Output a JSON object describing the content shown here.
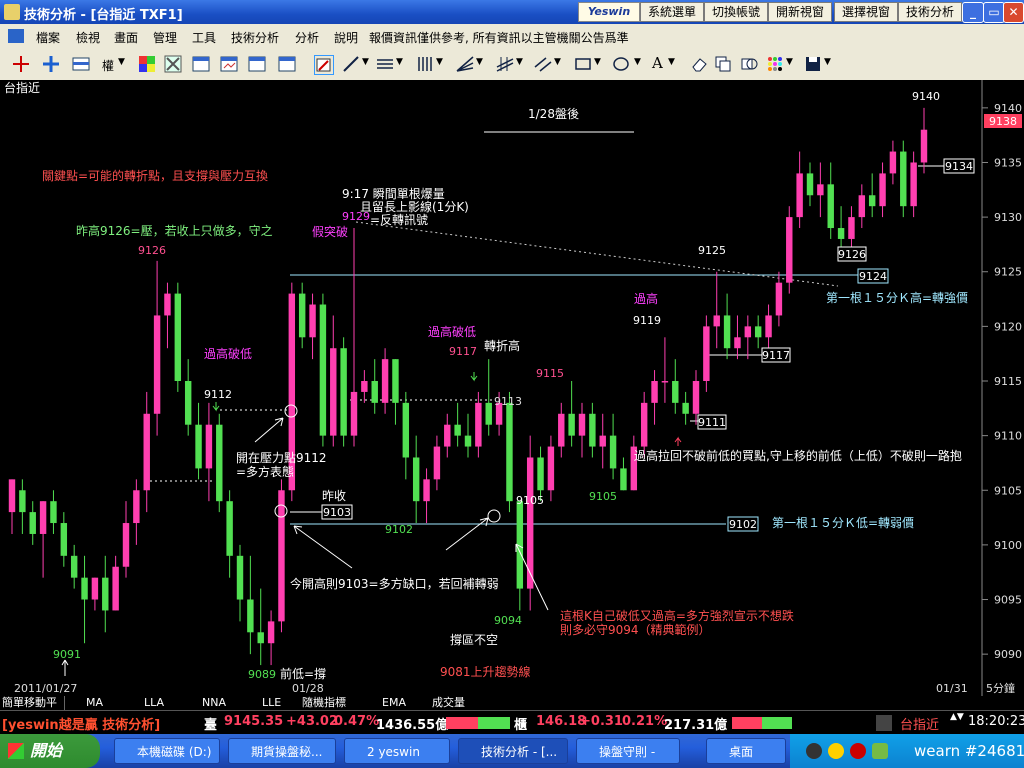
{
  "window": {
    "title": "技術分析 - [台指近 TXF1]",
    "logo": "Yeswin",
    "buttons": [
      "系統選單",
      "切換帳號",
      "開新視窗",
      "選擇視窗",
      "技術分析"
    ]
  },
  "menubar": {
    "items": [
      "檔案",
      "檢視",
      "畫面",
      "管理",
      "工具",
      "技術分析",
      "分析",
      "說明"
    ],
    "notice": "報價資訊僅供參考, 所有資訊以主管機關公告爲準"
  },
  "toolbar": {
    "quota_label": "權"
  },
  "chart": {
    "symbol": "台指近",
    "header": "1/28盤後",
    "price_axis": {
      "ticks": [
        "9140",
        "9135",
        "9130",
        "9125",
        "9120",
        "9115",
        "9110",
        "9105",
        "9100",
        "9095",
        "9090"
      ],
      "last_price": "9138",
      "range": [
        9088,
        9142
      ]
    },
    "date_labels": [
      "2011/01/27",
      "01/28",
      "01/31"
    ],
    "period": "5分鐘",
    "colors": {
      "up": "#ff3fb0",
      "down": "#52e052",
      "annot_red": "#ff5050",
      "annot_magenta": "#ff40ff",
      "line_cyan": "#a0e8ff"
    },
    "price_labels": {
      "p9126": "9126",
      "p9112": "9112",
      "p9091": "9091",
      "p9089": "9089",
      "p9102": "9102",
      "p9117": "9117",
      "p9115": "9115",
      "p9105a": "9105",
      "p9105b": "9105",
      "p9094": "9094",
      "p9119": "9119",
      "p9125": "9125",
      "p9140": "9140",
      "p9129": "9129"
    },
    "boxed_levels": {
      "b9134": "9134",
      "b9126": "9126",
      "b9124": "9124",
      "b9117": "9117",
      "b9111": "9111",
      "b9102": "9102",
      "b9103": "9103",
      "b9113": "9113"
    },
    "annotations": {
      "key_point": "關鍵點=可能的轉折點，且支撐與壓力互換",
      "prev_high": "昨高9126=壓，若收上只做多，守之",
      "break_high_1": "過高破低",
      "break_high_2": "過高破低",
      "open_above_1": "開在壓力點9112",
      "open_above_2": "=多方表態",
      "spike_1": "9:17  瞬間單根爆量",
      "spike_2": "且留長上影線(1分K)",
      "spike_3": "=反轉訊號",
      "false_break": "假突破",
      "turn_high": "轉折高",
      "over_high": "過高",
      "yesterday_close": "昨收",
      "first_k_high": "第一根１５分Ｋ高=轉強價",
      "first_k_low": "第一根１５分Ｋ低=轉弱價",
      "pullback": "過高拉回不破前低的買點,守上移的前低（上低）不破則一路抱",
      "gap_note": "今開高則9103=多方缺口，若回補轉弱",
      "self_break_1": "這根K自己破低又過高=多方強烈宣示不想跌",
      "self_break_2": "則多必守9094（精典範例）",
      "support_1": "撐區不空",
      "prev_low": "前低=撐",
      "uptrend": "9081上升趨勢線"
    },
    "bars": [
      {
        "o": 9103,
        "h": 9106,
        "l": 9101,
        "c": 9106
      },
      {
        "o": 9105,
        "h": 9106,
        "l": 9101,
        "c": 9103
      },
      {
        "o": 9103,
        "h": 9104,
        "l": 9100,
        "c": 9101
      },
      {
        "o": 9101,
        "h": 9104,
        "l": 9097,
        "c": 9104
      },
      {
        "o": 9104,
        "h": 9105,
        "l": 9101,
        "c": 9102
      },
      {
        "o": 9102,
        "h": 9103,
        "l": 9098,
        "c": 9099
      },
      {
        "o": 9099,
        "h": 9100,
        "l": 9096,
        "c": 9097
      },
      {
        "o": 9097,
        "h": 9099,
        "l": 9091,
        "c": 9095
      },
      {
        "o": 9095,
        "h": 9097,
        "l": 9094,
        "c": 9097
      },
      {
        "o": 9097,
        "h": 9099,
        "l": 9092,
        "c": 9094
      },
      {
        "o": 9094,
        "h": 9099,
        "l": 9094,
        "c": 9098
      },
      {
        "o": 9098,
        "h": 9104,
        "l": 9097,
        "c": 9102
      },
      {
        "o": 9102,
        "h": 9106,
        "l": 9100,
        "c": 9105
      },
      {
        "o": 9105,
        "h": 9114,
        "l": 9103,
        "c": 9112
      },
      {
        "o": 9112,
        "h": 9126,
        "l": 9110,
        "c": 9121
      },
      {
        "o": 9121,
        "h": 9124,
        "l": 9118,
        "c": 9123
      },
      {
        "o": 9123,
        "h": 9124,
        "l": 9114,
        "c": 9115
      },
      {
        "o": 9115,
        "h": 9117,
        "l": 9110,
        "c": 9111
      },
      {
        "o": 9111,
        "h": 9113,
        "l": 9106,
        "c": 9107
      },
      {
        "o": 9107,
        "h": 9113,
        "l": 9104,
        "c": 9111
      },
      {
        "o": 9111,
        "h": 9112,
        "l": 9103,
        "c": 9104
      },
      {
        "o": 9104,
        "h": 9105,
        "l": 9097,
        "c": 9099
      },
      {
        "o": 9099,
        "h": 9100,
        "l": 9093,
        "c": 9095
      },
      {
        "o": 9095,
        "h": 9099,
        "l": 9090,
        "c": 9092
      },
      {
        "o": 9092,
        "h": 9096,
        "l": 9089,
        "c": 9091
      },
      {
        "o": 9091,
        "h": 9094,
        "l": 9089,
        "c": 9093
      },
      {
        "o": 9093,
        "h": 9106,
        "l": 9092,
        "c": 9105
      },
      {
        "o": 9105,
        "h": 9124,
        "l": 9104,
        "c": 9123
      },
      {
        "o": 9123,
        "h": 9124,
        "l": 9118,
        "c": 9119
      },
      {
        "o": 9119,
        "h": 9123,
        "l": 9117,
        "c": 9122
      },
      {
        "o": 9122,
        "h": 9123,
        "l": 9109,
        "c": 9110
      },
      {
        "o": 9110,
        "h": 9121,
        "l": 9109,
        "c": 9118
      },
      {
        "o": 9118,
        "h": 9119,
        "l": 9109,
        "c": 9110
      },
      {
        "o": 9110,
        "h": 9129,
        "l": 9109,
        "c": 9114
      },
      {
        "o": 9114,
        "h": 9116,
        "l": 9113,
        "c": 9115
      },
      {
        "o": 9115,
        "h": 9117,
        "l": 9112,
        "c": 9113
      },
      {
        "o": 9113,
        "h": 9118,
        "l": 9112,
        "c": 9117
      },
      {
        "o": 9117,
        "h": 9117,
        "l": 9111,
        "c": 9113
      },
      {
        "o": 9113,
        "h": 9114,
        "l": 9106,
        "c": 9108
      },
      {
        "o": 9108,
        "h": 9110,
        "l": 9102,
        "c": 9104
      },
      {
        "o": 9104,
        "h": 9107,
        "l": 9102,
        "c": 9106
      },
      {
        "o": 9106,
        "h": 9110,
        "l": 9105,
        "c": 9109
      },
      {
        "o": 9109,
        "h": 9112,
        "l": 9108,
        "c": 9111
      },
      {
        "o": 9111,
        "h": 9113,
        "l": 9109,
        "c": 9110
      },
      {
        "o": 9110,
        "h": 9112,
        "l": 9108,
        "c": 9109
      },
      {
        "o": 9109,
        "h": 9114,
        "l": 9108,
        "c": 9113
      },
      {
        "o": 9113,
        "h": 9117,
        "l": 9110,
        "c": 9111
      },
      {
        "o": 9111,
        "h": 9114,
        "l": 9110,
        "c": 9113
      },
      {
        "o": 9113,
        "h": 9114,
        "l": 9103,
        "c": 9104
      },
      {
        "o": 9104,
        "h": 9104,
        "l": 9094,
        "c": 9096
      },
      {
        "o": 9096,
        "h": 9110,
        "l": 9094,
        "c": 9108
      },
      {
        "o": 9108,
        "h": 9109,
        "l": 9104,
        "c": 9105
      },
      {
        "o": 9105,
        "h": 9110,
        "l": 9104,
        "c": 9109
      },
      {
        "o": 9109,
        "h": 9113,
        "l": 9108,
        "c": 9112
      },
      {
        "o": 9112,
        "h": 9115,
        "l": 9109,
        "c": 9110
      },
      {
        "o": 9110,
        "h": 9113,
        "l": 9108,
        "c": 9112
      },
      {
        "o": 9112,
        "h": 9113,
        "l": 9108,
        "c": 9109
      },
      {
        "o": 9109,
        "h": 9112,
        "l": 9107,
        "c": 9110
      },
      {
        "o": 9110,
        "h": 9112,
        "l": 9106,
        "c": 9107
      },
      {
        "o": 9107,
        "h": 9108,
        "l": 9105,
        "c": 9105
      },
      {
        "o": 9105,
        "h": 9110,
        "l": 9105,
        "c": 9109
      },
      {
        "o": 9109,
        "h": 9114,
        "l": 9108,
        "c": 9113
      },
      {
        "o": 9113,
        "h": 9116,
        "l": 9111,
        "c": 9115
      },
      {
        "o": 9115,
        "h": 9119,
        "l": 9113,
        "c": 9115
      },
      {
        "o": 9115,
        "h": 9117,
        "l": 9112,
        "c": 9113
      },
      {
        "o": 9113,
        "h": 9114,
        "l": 9111,
        "c": 9112
      },
      {
        "o": 9112,
        "h": 9116,
        "l": 9111,
        "c": 9115
      },
      {
        "o": 9115,
        "h": 9121,
        "l": 9114,
        "c": 9120
      },
      {
        "o": 9120,
        "h": 9125,
        "l": 9118,
        "c": 9121
      },
      {
        "o": 9121,
        "h": 9123,
        "l": 9117,
        "c": 9118
      },
      {
        "o": 9118,
        "h": 9121,
        "l": 9117,
        "c": 9119
      },
      {
        "o": 9119,
        "h": 9121,
        "l": 9117,
        "c": 9120
      },
      {
        "o": 9120,
        "h": 9121,
        "l": 9118,
        "c": 9119
      },
      {
        "o": 9119,
        "h": 9122,
        "l": 9118,
        "c": 9121
      },
      {
        "o": 9121,
        "h": 9125,
        "l": 9120,
        "c": 9124
      },
      {
        "o": 9124,
        "h": 9131,
        "l": 9123,
        "c": 9130
      },
      {
        "o": 9130,
        "h": 9136,
        "l": 9129,
        "c": 9134
      },
      {
        "o": 9134,
        "h": 9135,
        "l": 9131,
        "c": 9132
      },
      {
        "o": 9132,
        "h": 9135,
        "l": 9130,
        "c": 9133
      },
      {
        "o": 9133,
        "h": 9135,
        "l": 9128,
        "c": 9129
      },
      {
        "o": 9129,
        "h": 9131,
        "l": 9127,
        "c": 9128
      },
      {
        "o": 9128,
        "h": 9131,
        "l": 9127,
        "c": 9130
      },
      {
        "o": 9130,
        "h": 9133,
        "l": 9129,
        "c": 9132
      },
      {
        "o": 9132,
        "h": 9134,
        "l": 9130,
        "c": 9131
      },
      {
        "o": 9131,
        "h": 9135,
        "l": 9130,
        "c": 9134
      },
      {
        "o": 9134,
        "h": 9137,
        "l": 9133,
        "c": 9136
      },
      {
        "o": 9136,
        "h": 9137,
        "l": 9130,
        "c": 9131
      },
      {
        "o": 9131,
        "h": 9136,
        "l": 9130,
        "c": 9135
      },
      {
        "o": 9135,
        "h": 9140,
        "l": 9134,
        "c": 9138
      }
    ]
  },
  "tabs": {
    "items": [
      "簡單移動平",
      "MA",
      "LLA",
      "NNA",
      "LLE",
      "隨機指標",
      "EMA",
      "成交量"
    ]
  },
  "quotebar": {
    "brand": "[yeswin越是贏 技術分析]",
    "idx1_name": "臺",
    "idx1_value": "9145.35",
    "idx1_change": "+43.02",
    "idx1_pct": "0.47%",
    "idx1_volume": "1436.55億",
    "idx2_name": "櫃",
    "idx2_value": "146.18",
    "idx2_change": "+0.31",
    "idx2_pct": "0.21%",
    "idx2_volume": "217.31億",
    "symbol": "台指近",
    "time": "18:20:23"
  },
  "taskbar": {
    "start": "開始",
    "tasks": [
      "本機磁碟 (D:)",
      "期貨操盤秘...",
      "2 yeswin",
      "技術分析 - [...",
      "操盤守則 -",
      "桌面"
    ],
    "watermark": "wearn #24681"
  }
}
